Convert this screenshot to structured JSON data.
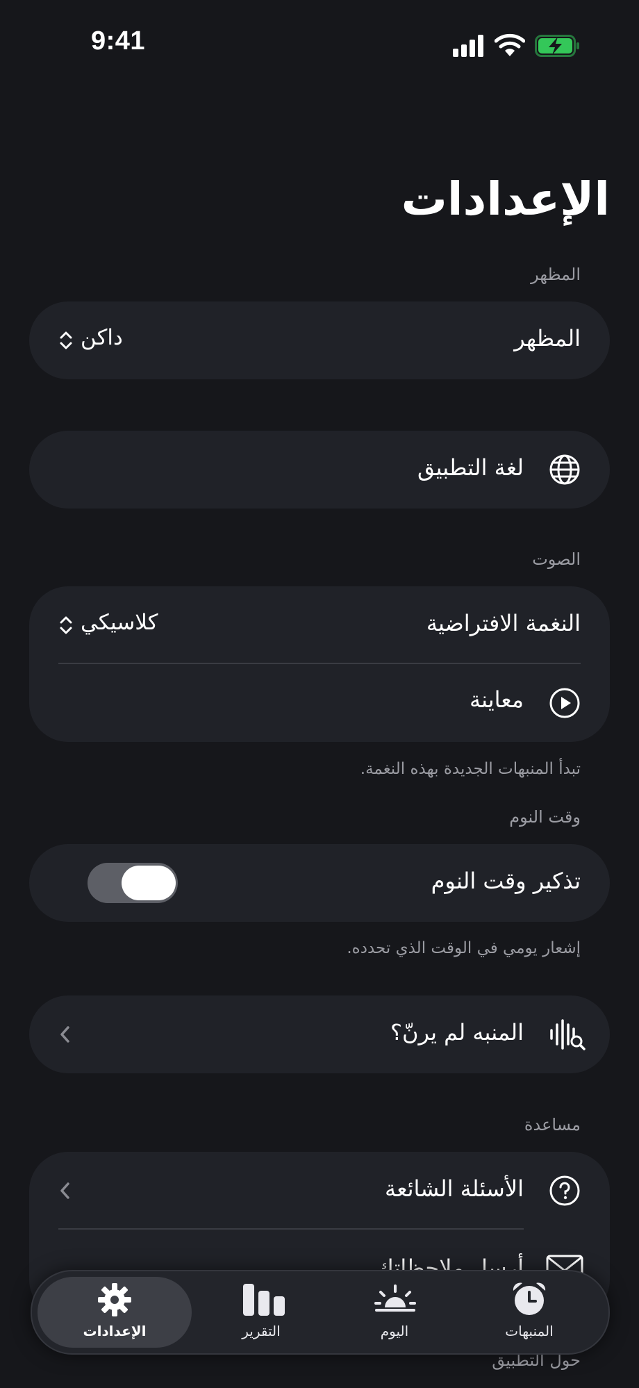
{
  "status_bar": {
    "time": "9:41"
  },
  "page": {
    "title": "الإعدادات"
  },
  "appearance": {
    "section_header": "المظهر",
    "row_label": "المظهر",
    "value": "داكن"
  },
  "language": {
    "row_label": "لغة التطبيق",
    "icon": "globe-icon"
  },
  "sound": {
    "section_header": "الصوت",
    "default_tone_label": "النغمة الافتراضية",
    "default_tone_value": "كلاسيكي",
    "preview_label": "معاينة",
    "footnote": "تبدأ المنبهات الجديدة بهذه النغمة."
  },
  "bedtime": {
    "section_header": "وقت النوم",
    "reminder_label": "تذكير وقت النوم",
    "reminder_enabled": true,
    "footnote": "إشعار يومي في الوقت الذي تحدده."
  },
  "troubleshoot": {
    "row_label": "المنبه لم يرنّ؟"
  },
  "help": {
    "section_header": "مساعدة",
    "faq_label": "الأسئلة الشائعة",
    "contact_label": "أرسل ملاحظاتك",
    "about_header": "حول التطبيق"
  },
  "tab_bar": {
    "tabs": [
      {
        "label": "الإعدادات",
        "icon": "gear-icon",
        "active": true
      },
      {
        "label": "التقرير",
        "icon": "bar-chart-icon",
        "active": false
      },
      {
        "label": "اليوم",
        "icon": "sunrise-icon",
        "active": false
      },
      {
        "label": "المنبهات",
        "icon": "alarm-clock-icon",
        "active": false
      }
    ]
  },
  "colors": {
    "background": "#16171b",
    "card": "#202228",
    "secondary_text": "#9b9ca3",
    "battery_green": "#34c759"
  }
}
